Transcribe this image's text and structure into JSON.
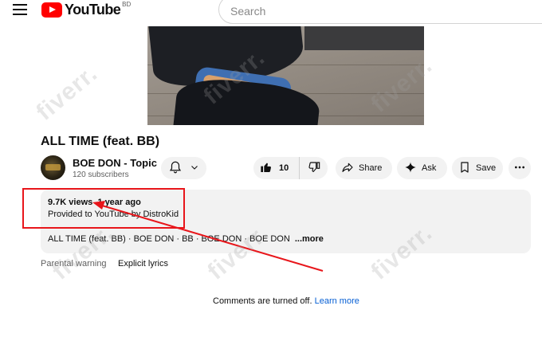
{
  "header": {
    "logo_text": "YouTube",
    "country_code": "BD",
    "search_placeholder": "Search"
  },
  "video": {
    "title": "ALL TIME (feat. BB)"
  },
  "channel": {
    "name": "BOE DON - Topic",
    "subscribers": "120 subscribers"
  },
  "actions": {
    "like_count": "10",
    "share_label": "Share",
    "ask_label": "Ask",
    "save_label": "Save"
  },
  "description": {
    "views": "9.7K views",
    "age": "1 year ago",
    "provided_by": "Provided to YouTube by DistroKid",
    "summary": "ALL TIME (feat. BB) · BOE DON · BB · BOE DON · BOE DON",
    "more_label": "...more"
  },
  "parental": {
    "label": "Parental warning",
    "value": "Explicit lyrics"
  },
  "comments": {
    "text": "Comments are turned off.",
    "link_label": "Learn more"
  },
  "annotation": {
    "color": "#e8161b"
  },
  "watermark": {
    "text": "fiverr."
  },
  "colors": {
    "brand_red": "#ff0000",
    "link_blue": "#065fd4",
    "pill_bg": "#f2f2f2"
  }
}
